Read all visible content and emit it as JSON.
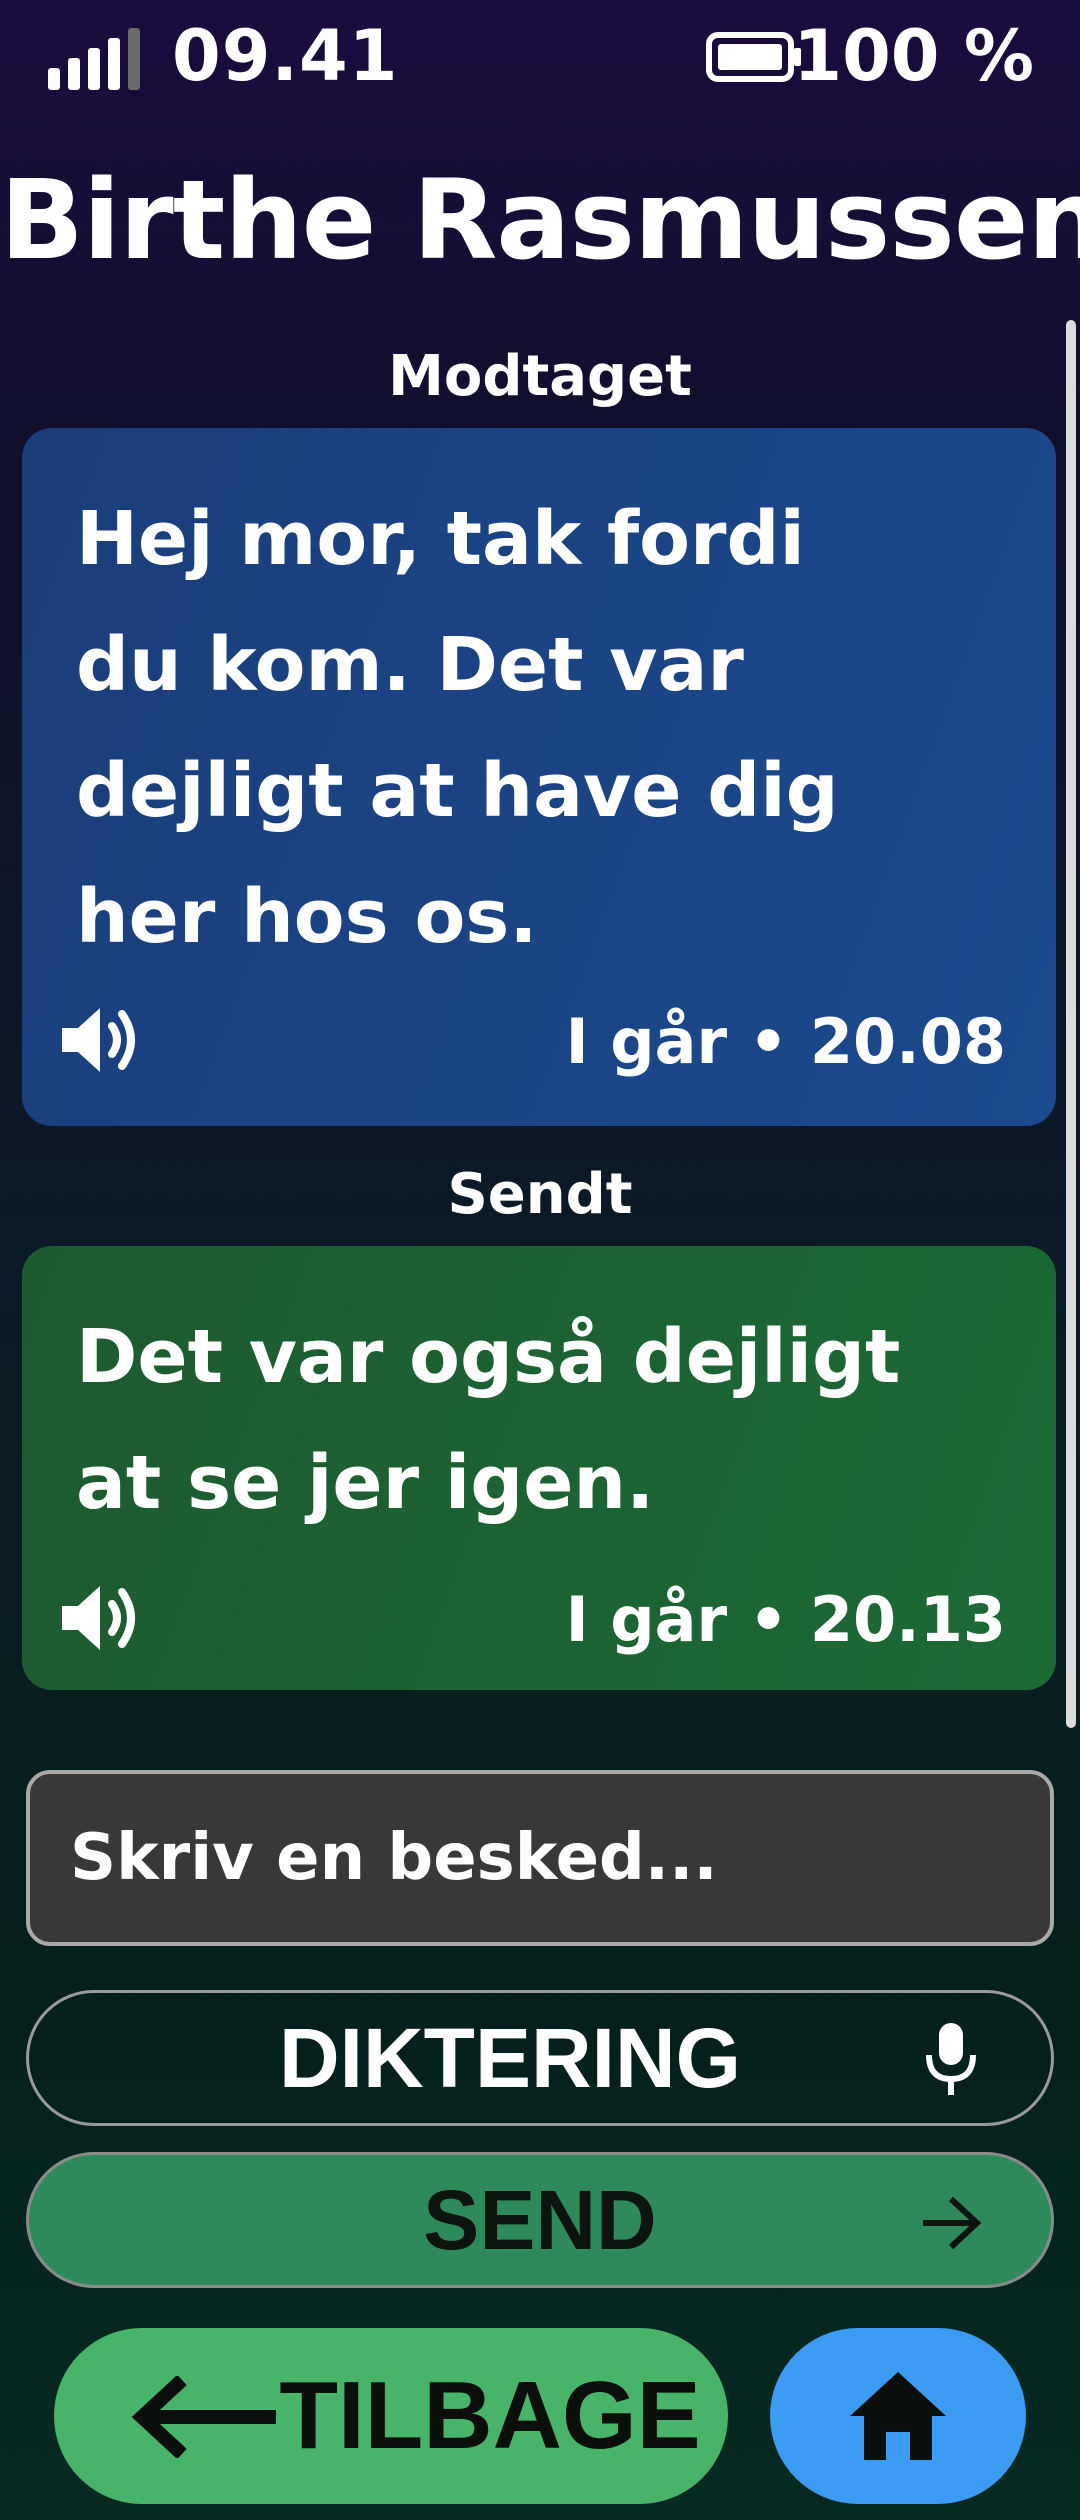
{
  "status_bar": {
    "time": "09.41",
    "battery": "100 %",
    "icons": [
      "signal-icon",
      "battery-icon"
    ]
  },
  "contact": {
    "name": "Birthe Rasmussen"
  },
  "messages": [
    {
      "direction_label": "Modtaget",
      "text": "Hej mor, tak fordi du kom. Det var dejligt at have dig her hos os.",
      "time": "I går • 20.08",
      "icon": "speaker-icon",
      "color": "#1b4a8e"
    },
    {
      "direction_label": "Sendt",
      "text": "Det var også dejligt at se jer igen.",
      "time": "I går • 20.13",
      "icon": "speaker-icon",
      "color": "#1c6a36"
    }
  ],
  "composer": {
    "placeholder": "Skriv en besked..."
  },
  "buttons": {
    "dictate_label": "DIKTERING",
    "dictate_icon": "microphone-icon",
    "send_label": "SEND",
    "send_icon": "arrow-right-icon",
    "back_label": "TILBAGE",
    "back_icon": "arrow-left-icon",
    "home_icon": "home-icon"
  },
  "colors": {
    "send_button": "#2e8a5a",
    "back_button": "#48b46a",
    "home_button": "#3c9cf4"
  }
}
